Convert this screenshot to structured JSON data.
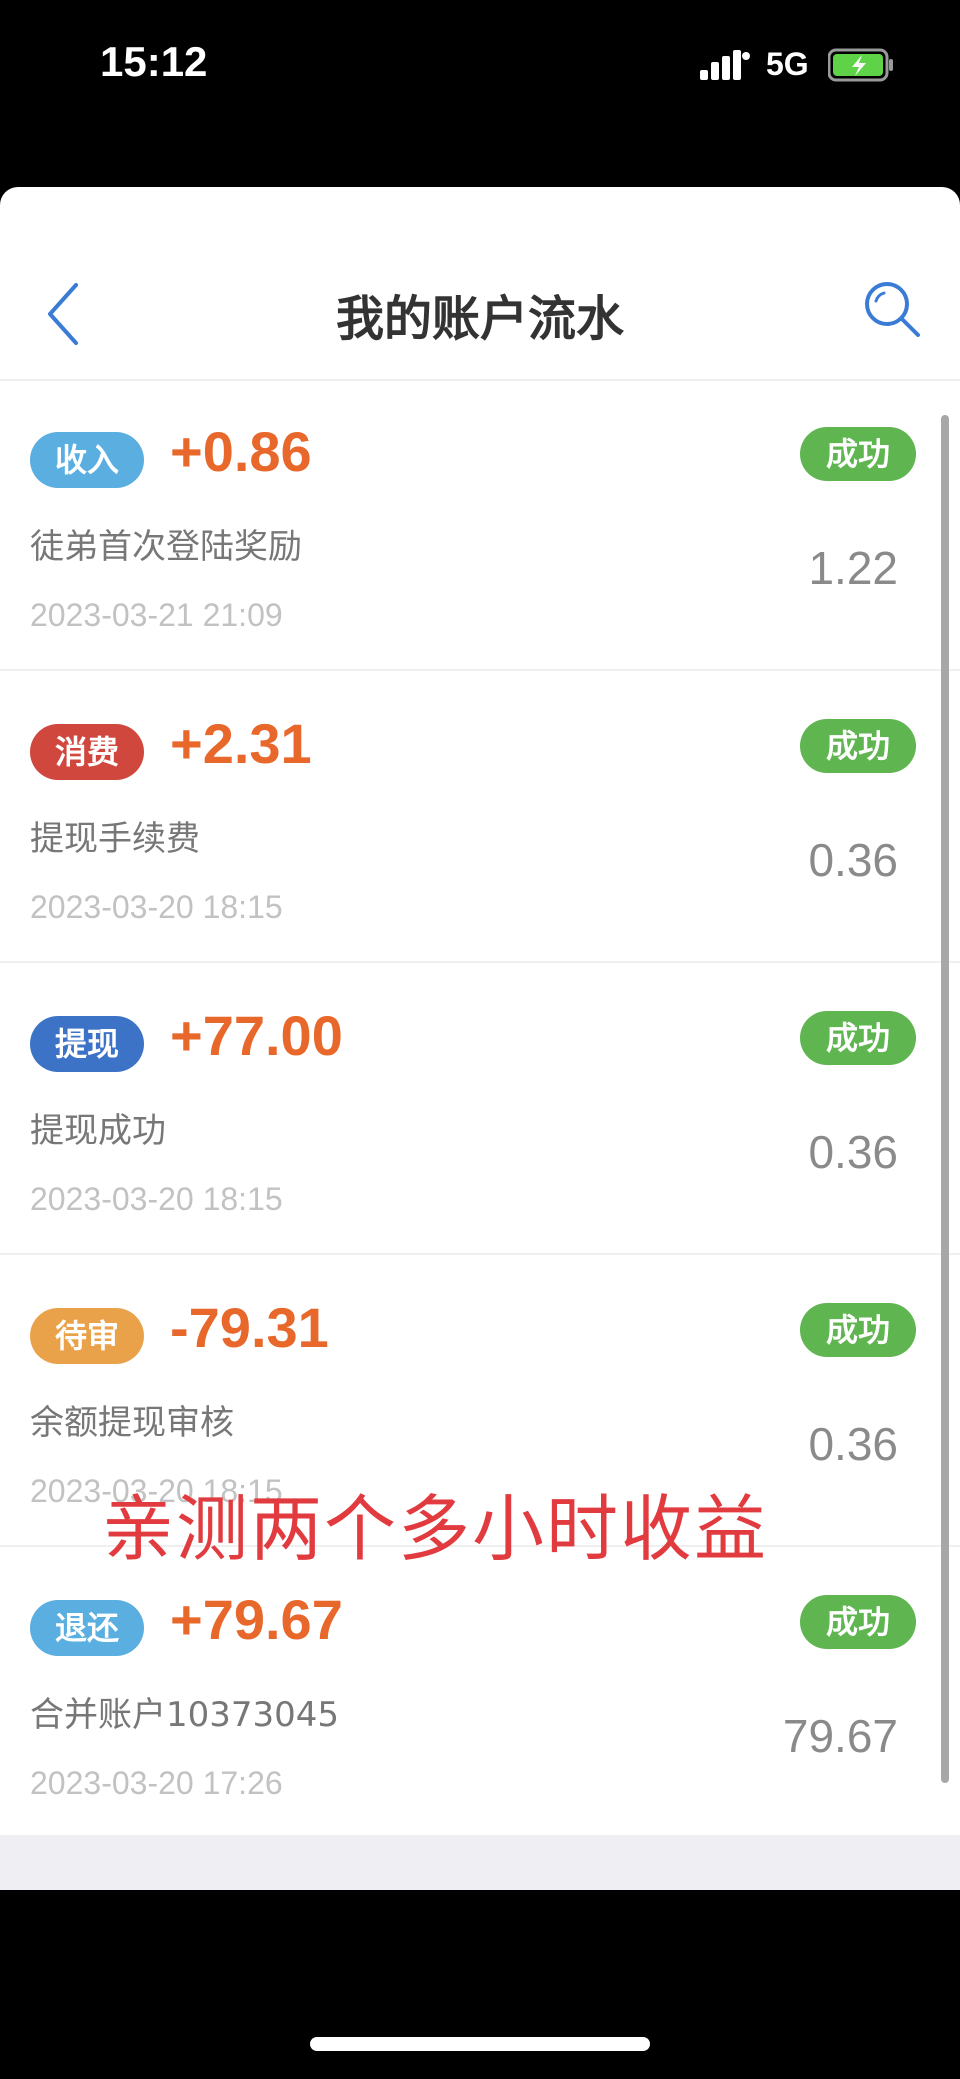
{
  "status_bar": {
    "time": "15:12",
    "network": "5G",
    "signal_icon": "signal-icon",
    "battery_icon": "battery-charging-icon"
  },
  "header": {
    "title": "我的账户流水",
    "back_icon": "chevron-left-icon",
    "search_icon": "search-icon"
  },
  "transactions": [
    {
      "type_label": "收入",
      "type_color": "#5aaee0",
      "amount": "+0.86",
      "status": "成功",
      "description": "徒弟首次登陆奖励",
      "balance": "1.22",
      "time": "2023-03-21 21:09"
    },
    {
      "type_label": "消费",
      "type_color": "#d0473e",
      "amount": "+2.31",
      "status": "成功",
      "description": "提现手续费",
      "balance": "0.36",
      "time": "2023-03-20 18:15"
    },
    {
      "type_label": "提现",
      "type_color": "#3d73c6",
      "amount": "+77.00",
      "status": "成功",
      "description": "提现成功",
      "balance": "0.36",
      "time": "2023-03-20 18:15"
    },
    {
      "type_label": "待审",
      "type_color": "#eaa24a",
      "amount": "-79.31",
      "status": "成功",
      "description": "余额提现审核",
      "balance": "0.36",
      "time": "2023-03-20 18:15"
    },
    {
      "type_label": "退还",
      "type_color": "#5aaee0",
      "amount": "+79.67",
      "status": "成功",
      "description": "合并账户10373045",
      "balance": "79.67",
      "time": "2023-03-20 17:26"
    }
  ],
  "overlay_caption": "亲测两个多小时收益",
  "colors": {
    "amount": "#e8672a",
    "status_success": "#5fb54f",
    "accent": "#3a7bd5",
    "caption": "#e23b3f"
  }
}
